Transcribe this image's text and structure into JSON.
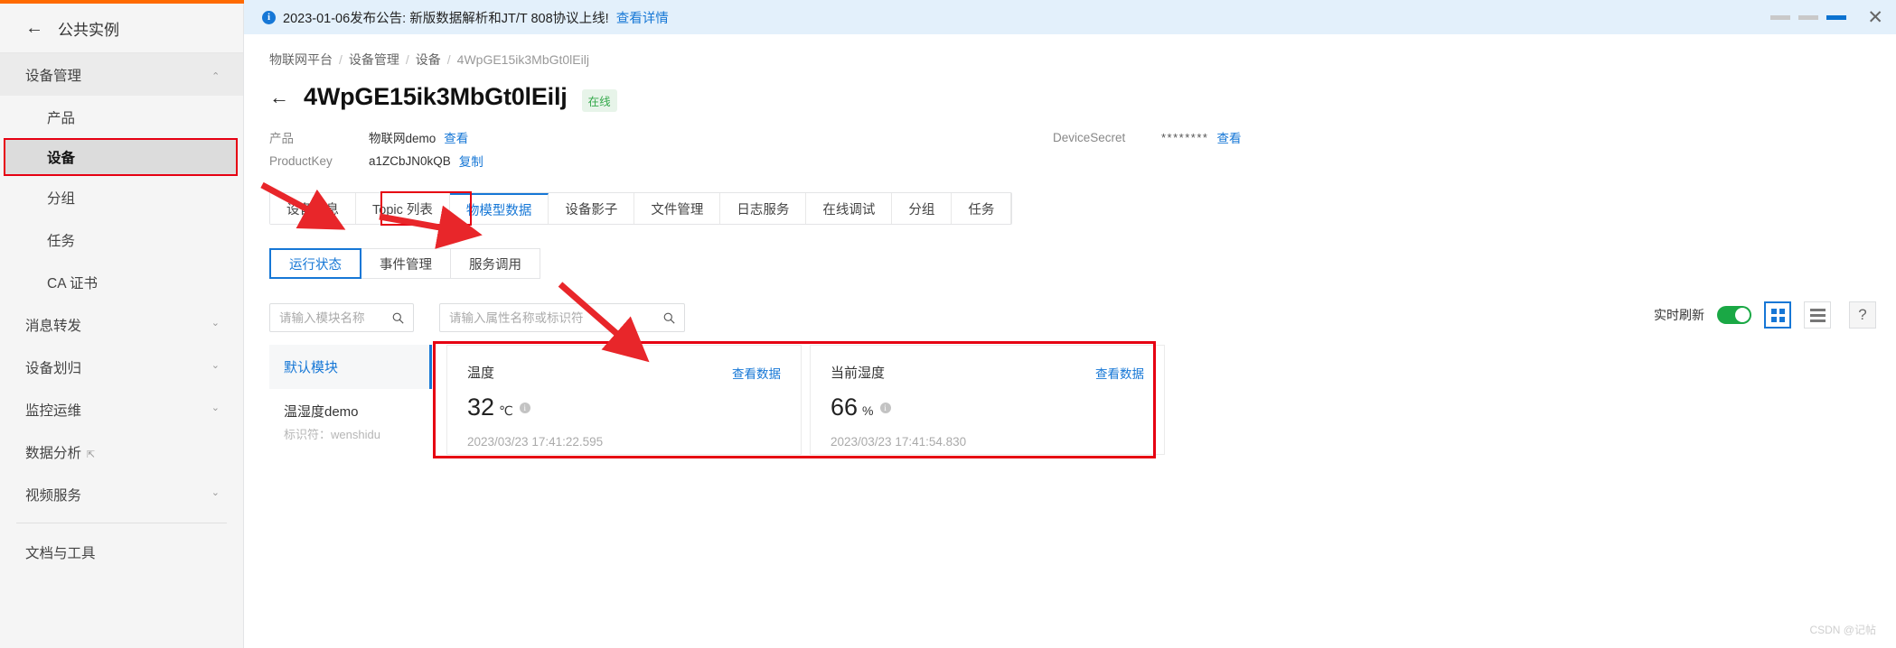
{
  "sidebar": {
    "back_label": "公共实例",
    "groups": [
      {
        "label": "设备管理",
        "expanded": true,
        "items": [
          {
            "label": "产品",
            "active": false
          },
          {
            "label": "设备",
            "active": true
          },
          {
            "label": "分组",
            "active": false
          },
          {
            "label": "任务",
            "active": false
          },
          {
            "label": "CA 证书",
            "active": false
          }
        ]
      },
      {
        "label": "消息转发",
        "expanded": false,
        "items": []
      },
      {
        "label": "设备划归",
        "expanded": false,
        "items": []
      },
      {
        "label": "监控运维",
        "expanded": false,
        "items": []
      }
    ],
    "data_analysis": "数据分析",
    "video_service": "视频服务",
    "docs_tools": "文档与工具"
  },
  "notice": {
    "text": "2023-01-06发布公告: 新版数据解析和JT/T 808协议上线!",
    "link": "查看详情"
  },
  "breadcrumb": [
    "物联网平台",
    "设备管理",
    "设备",
    "4WpGE15ik3MbGt0lEilj"
  ],
  "header": {
    "title": "4WpGE15ik3MbGt0lEilj",
    "status_badge": "在线"
  },
  "info": {
    "product_label": "产品",
    "product_value": "物联网demo",
    "product_link": "查看",
    "productkey_label": "ProductKey",
    "productkey_value": "a1ZCbJN0kQB",
    "productkey_link": "复制",
    "devicesecret_label": "DeviceSecret",
    "devicesecret_value": "********",
    "devicesecret_link": "查看"
  },
  "tabs": [
    {
      "label": "设备信息",
      "active": false
    },
    {
      "label": "Topic 列表",
      "active": false
    },
    {
      "label": "物模型数据",
      "active": true
    },
    {
      "label": "设备影子",
      "active": false
    },
    {
      "label": "文件管理",
      "active": false
    },
    {
      "label": "日志服务",
      "active": false
    },
    {
      "label": "在线调试",
      "active": false
    },
    {
      "label": "分组",
      "active": false
    },
    {
      "label": "任务",
      "active": false
    }
  ],
  "subtabs": [
    {
      "label": "运行状态",
      "active": true
    },
    {
      "label": "事件管理",
      "active": false
    },
    {
      "label": "服务调用",
      "active": false
    }
  ],
  "search": {
    "module_placeholder": "请输入模块名称",
    "module_value": "",
    "property_placeholder": "请输入属性名称或标识符",
    "property_value": ""
  },
  "toolbar": {
    "realtime_label": "实时刷新",
    "realtime_on": true,
    "help_label": "?"
  },
  "modules": [
    {
      "name": "默认模块",
      "sub": "",
      "active": true
    },
    {
      "name": "温湿度demo",
      "sub": "标识符：wenshidu",
      "active": false
    }
  ],
  "properties": [
    {
      "name": "温度",
      "link": "查看数据",
      "value": "32",
      "unit": "℃",
      "timestamp": "2023/03/23 17:41:22.595"
    },
    {
      "name": "当前湿度",
      "link": "查看数据",
      "value": "66",
      "unit": "%",
      "timestamp": "2023/03/23 17:41:54.830"
    }
  ],
  "watermark": "CSDN @记帖",
  "colors": {
    "accent": "#1677d6",
    "highlight": "#e60012",
    "online": "#35a94b",
    "toggle_on": "#1aa845"
  }
}
